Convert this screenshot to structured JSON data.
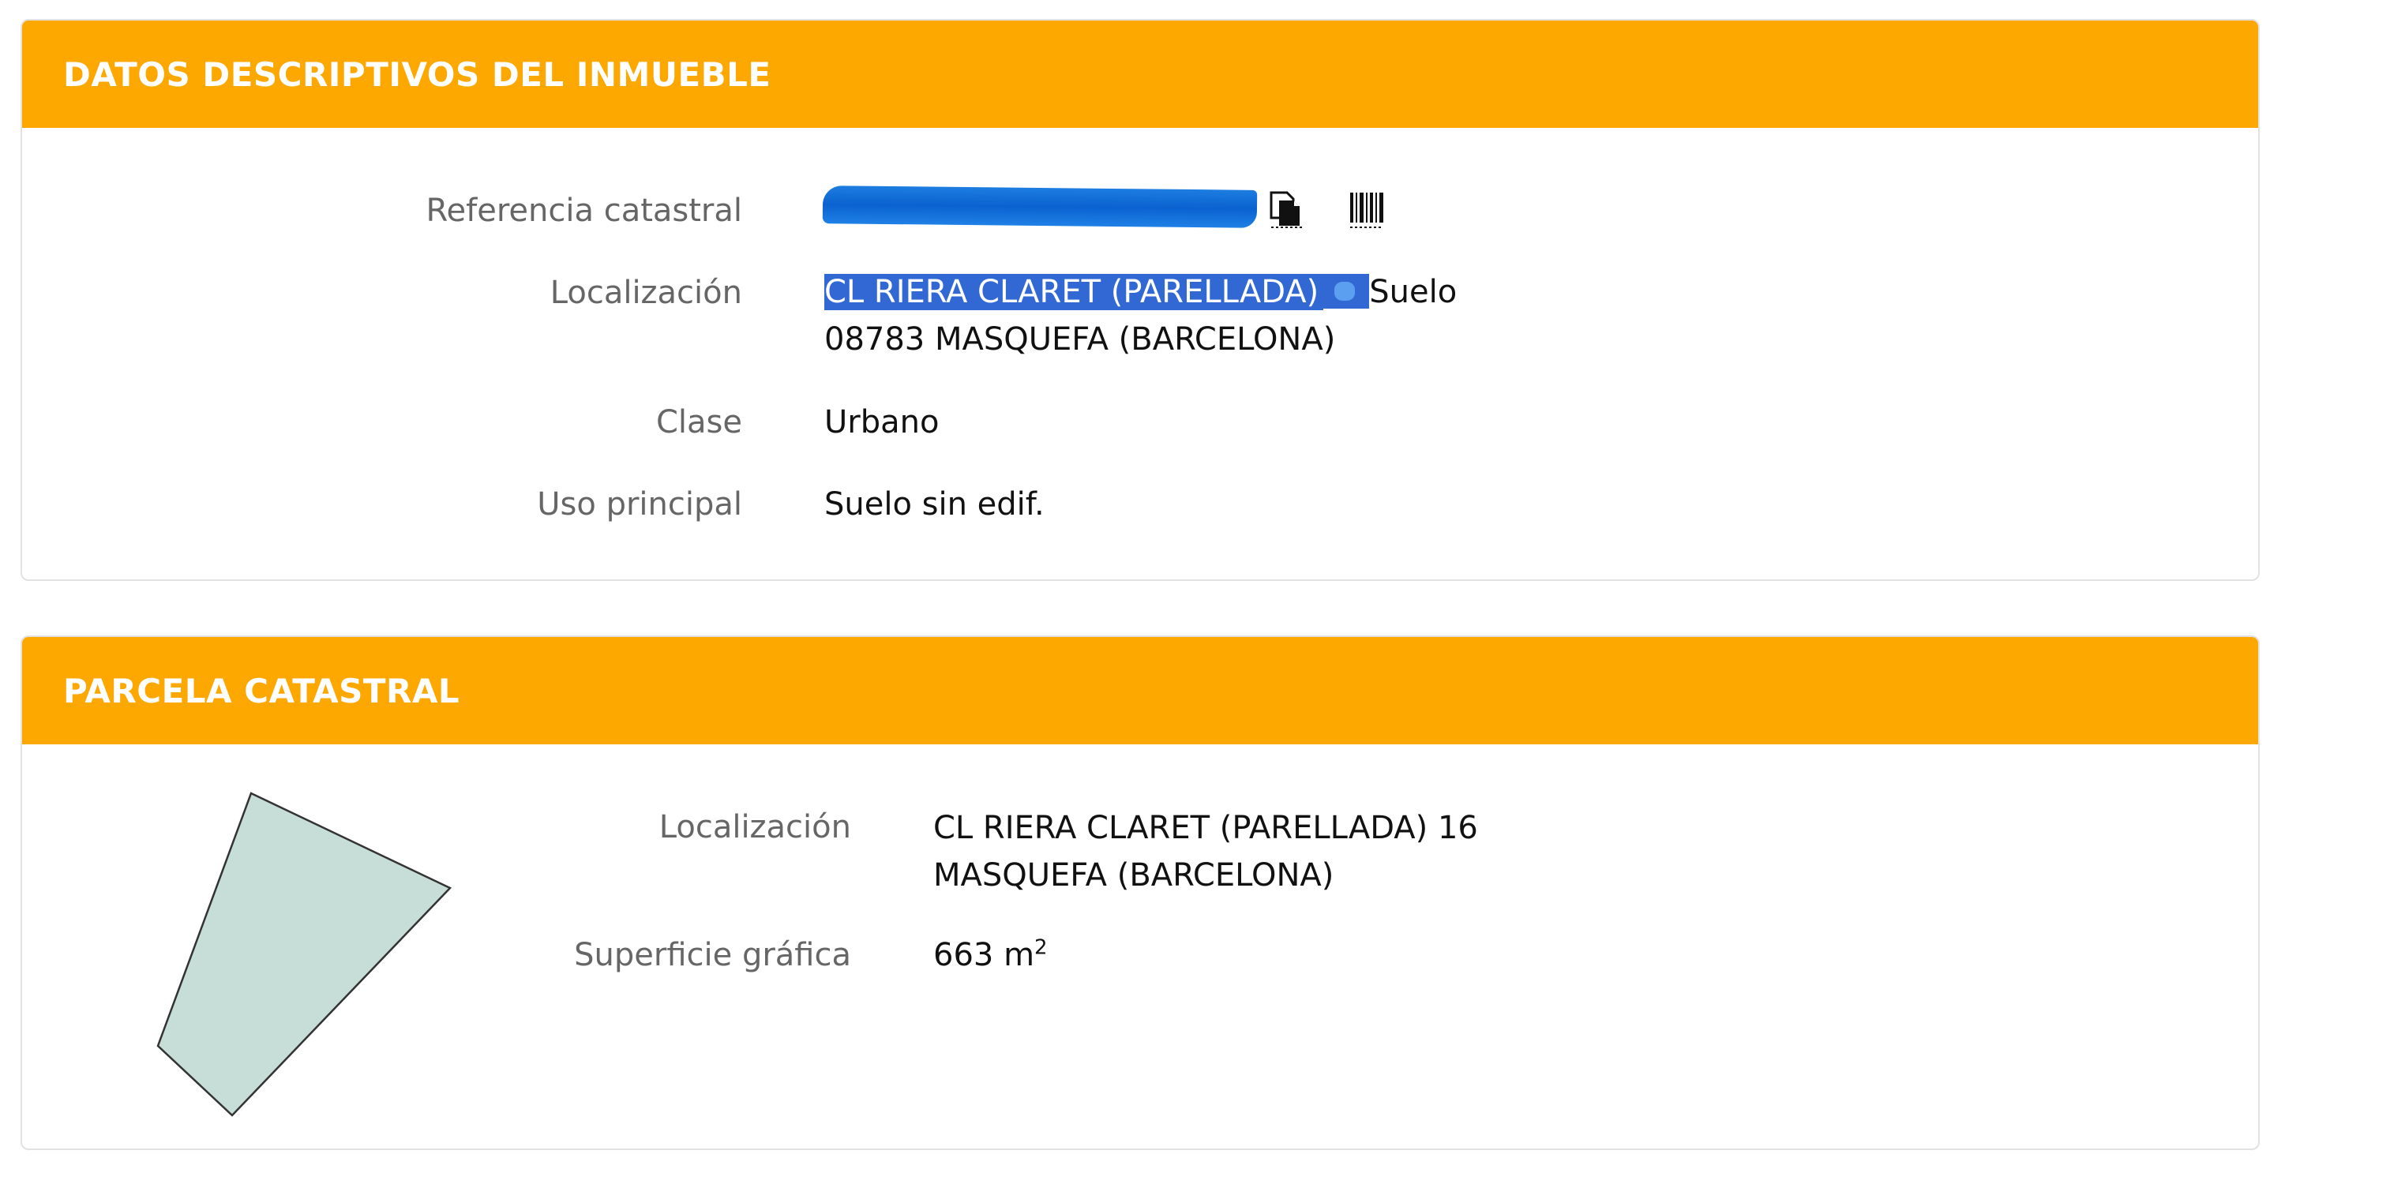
{
  "panel_inmueble": {
    "title": "DATOS DESCRIPTIVOS DEL INMUEBLE",
    "rows": {
      "referencia": {
        "label": "Referencia catastral"
      },
      "localizacion": {
        "label": "Localización",
        "line1_highlighted": "CL RIERA CLARET (PARELLADA)",
        "line1_suffix": "Suelo",
        "line2": "08783 MASQUEFA (BARCELONA)"
      },
      "clase": {
        "label": "Clase",
        "value": "Urbano"
      },
      "uso": {
        "label": "Uso principal",
        "value": "Suelo sin edif."
      }
    },
    "icons": [
      "copy-document-icon",
      "barcode-icon"
    ]
  },
  "panel_parcela": {
    "title": "PARCELA CATASTRAL",
    "rows": {
      "localizacion": {
        "label": "Localización",
        "line1": "CL RIERA CLARET (PARELLADA) 16",
        "line2": "MASQUEFA (BARCELONA)"
      },
      "superficie": {
        "label": "Superficie gráfica",
        "value": "663 m",
        "unit_exponent": "2"
      }
    },
    "parcel_shape_fill": "#c6ded7",
    "parcel_shape_stroke": "#333333"
  },
  "colors": {
    "header": "#fda800",
    "selection": "#3168d3",
    "label": "#666666"
  }
}
